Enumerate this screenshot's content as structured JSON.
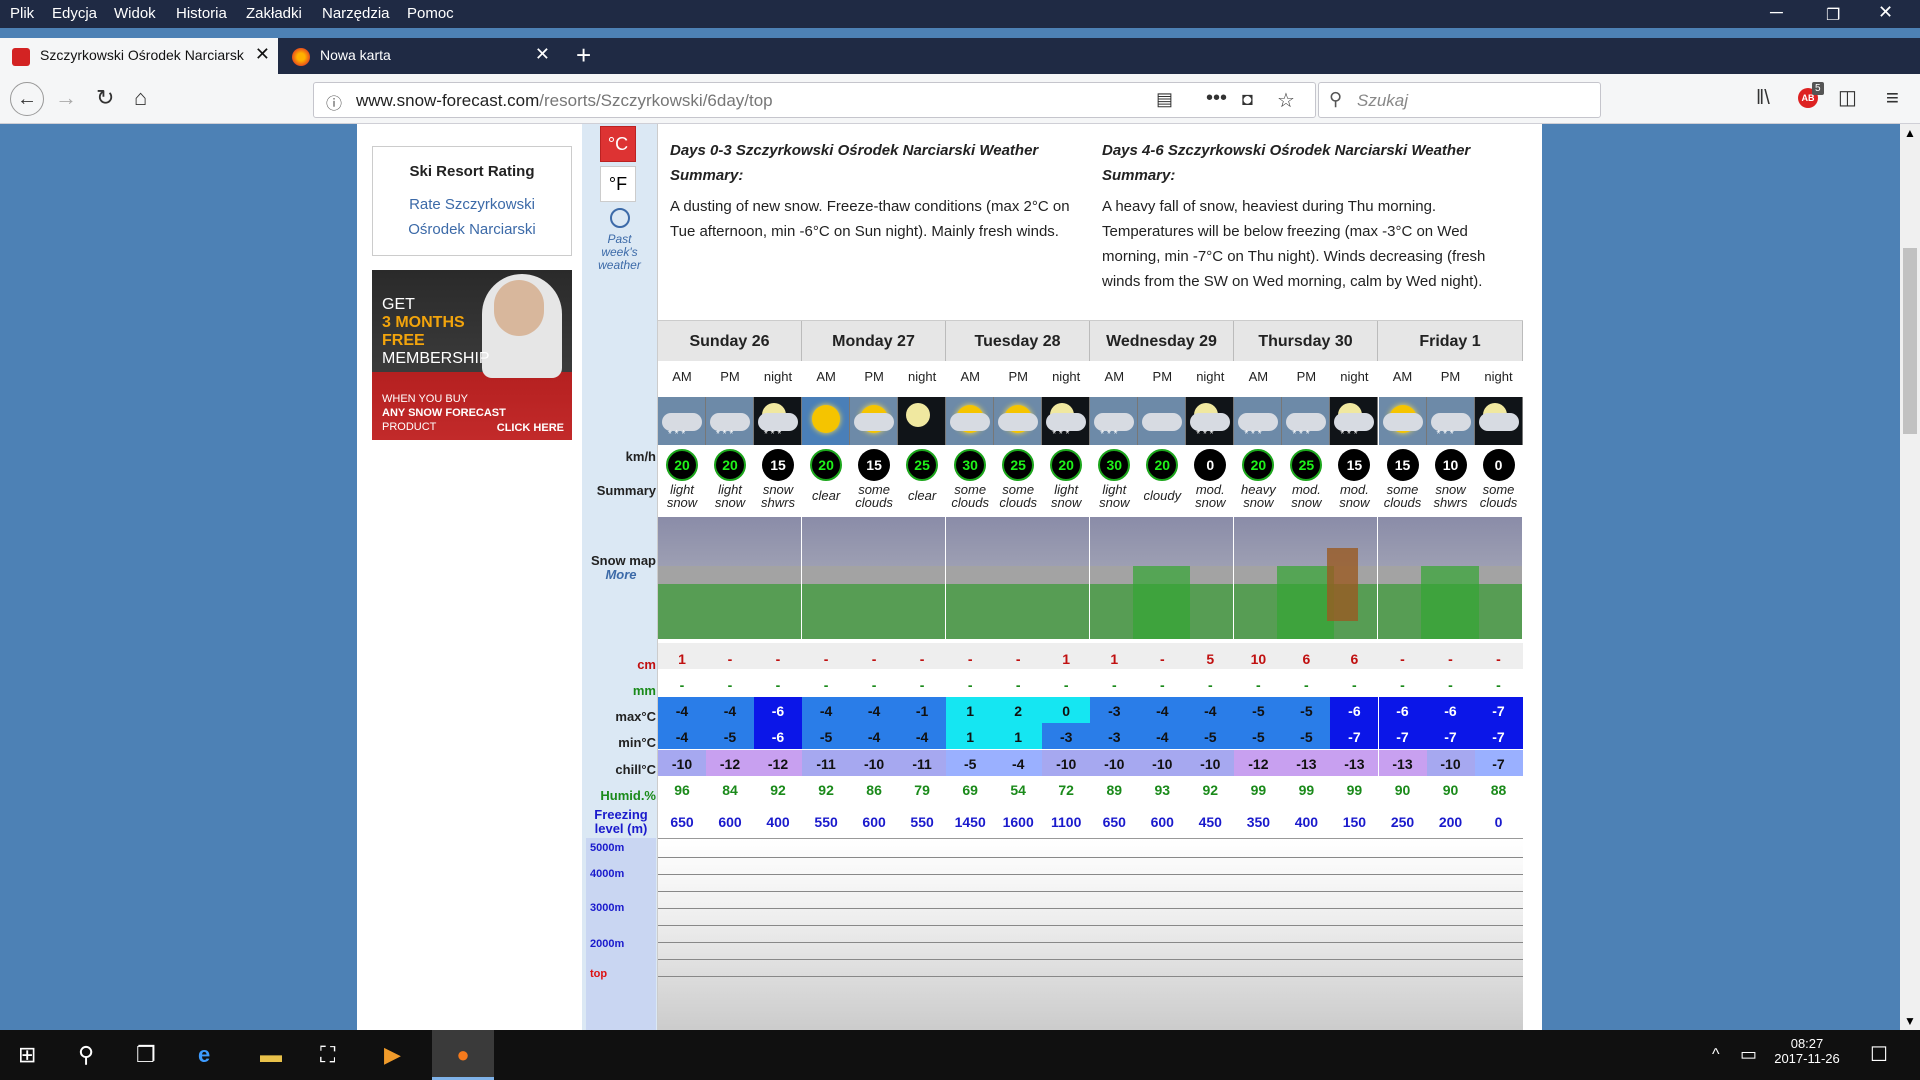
{
  "menu": [
    "Plik",
    "Edycja",
    "Widok",
    "Historia",
    "Zakładki",
    "Narzędzia",
    "Pomoc"
  ],
  "tabs": [
    {
      "label": "Szczyrkowski Ośrodek Narciarsk"
    },
    {
      "label": "Nowa karta"
    }
  ],
  "url": {
    "host": "www.snow-forecast.com",
    "path": "/resorts/Szczyrkowski/6day/top"
  },
  "search": {
    "placeholder": "Szukaj"
  },
  "addon_badge": "5",
  "left": {
    "rating_title": "Ski Resort Rating",
    "rating_link_1": "Rate Szczyrkowski",
    "rating_link_2": "Ośrodek Narciarski",
    "ad": {
      "l1": "GET",
      "l2": "3 MONTHS",
      "l3": "FREE",
      "l4": "MEMBERSHIP",
      "l5": "WHEN YOU BUY",
      "l6": "ANY SNOW FORECAST",
      "l7": "PRODUCT",
      "cta": "CLICK HERE"
    }
  },
  "units": {
    "c": "°C",
    "f": "°F"
  },
  "past": {
    "l1": "Past",
    "l2": "week's",
    "l3": "weather"
  },
  "summary": [
    {
      "title": "Days 0-3 Szczyrkowski Ośrodek Narciarski Weather Summary:",
      "text": "A dusting of new snow. Freeze-thaw conditions (max 2°C on Tue afternoon, min -6°C on Sun night). Mainly fresh winds."
    },
    {
      "title": "Days 4-6 Szczyrkowski Ośrodek Narciarski Weather Summary:",
      "text": "A heavy fall of snow, heaviest during Thu morning. Temperatures will be below freezing (max -3°C on Wed morning, min -7°C on Thu night). Winds decreasing (fresh winds from the SW on Wed morning, calm by Wed night)."
    }
  ],
  "days": [
    "Sunday 26",
    "Monday 27",
    "Tuesday 28",
    "Wednesday 29",
    "Thursday 30",
    "Friday 1"
  ],
  "periods": [
    "AM",
    "PM",
    "night"
  ],
  "labels": {
    "kmh": "km/h",
    "summary": "Summary",
    "snowmap": "Snow map",
    "more": "More",
    "cm": "cm",
    "mm": "mm",
    "max": "max°C",
    "min": "min°C",
    "chill": "chill°C",
    "humid": "Humid.%",
    "freezing_1": "Freezing",
    "freezing_2": "level (m)",
    "alt": [
      "5000m",
      "4000m",
      "3000m",
      "2000m",
      "top"
    ]
  },
  "icons": [
    "light-snow",
    "light-snow",
    "snow-showers-night",
    "clear-sun",
    "some-clouds-sun",
    "clear-night",
    "some-clouds-sun",
    "some-clouds-sun",
    "light-snow-night",
    "light-snow",
    "cloudy",
    "mod-snow-night",
    "heavy-snow",
    "mod-snow",
    "mod-snow-night",
    "some-clouds-sun",
    "snow-showers",
    "some-clouds-night"
  ],
  "wind": [
    20,
    20,
    15,
    20,
    15,
    25,
    30,
    25,
    20,
    30,
    20,
    0,
    20,
    25,
    15,
    15,
    10,
    0
  ],
  "wind_green": [
    true,
    true,
    false,
    true,
    false,
    true,
    true,
    true,
    true,
    true,
    true,
    false,
    true,
    true,
    false,
    false,
    false,
    false
  ],
  "summ": [
    [
      "light",
      "snow"
    ],
    [
      "light",
      "snow"
    ],
    [
      "snow",
      "shwrs"
    ],
    [
      "clear",
      ""
    ],
    [
      "some",
      "clouds"
    ],
    [
      "clear",
      ""
    ],
    [
      "some",
      "clouds"
    ],
    [
      "some",
      "clouds"
    ],
    [
      "light",
      "snow"
    ],
    [
      "light",
      "snow"
    ],
    [
      "cloudy",
      ""
    ],
    [
      "mod.",
      "snow"
    ],
    [
      "heavy",
      "snow"
    ],
    [
      "mod.",
      "snow"
    ],
    [
      "mod.",
      "snow"
    ],
    [
      "some",
      "clouds"
    ],
    [
      "snow",
      "shwrs"
    ],
    [
      "some",
      "clouds"
    ]
  ],
  "snow_cm": [
    "1",
    "-",
    "-",
    "-",
    "-",
    "-",
    "-",
    "-",
    "1",
    "1",
    "-",
    "5",
    "10",
    "6",
    "6",
    "-",
    "-",
    "-"
  ],
  "rain_mm": [
    "-",
    "-",
    "-",
    "-",
    "-",
    "-",
    "-",
    "-",
    "-",
    "-",
    "-",
    "-",
    "-",
    "-",
    "-",
    "-",
    "-",
    "-"
  ],
  "max_c": [
    "-4",
    "-4",
    "-6",
    "-4",
    "-4",
    "-1",
    "1",
    "2",
    "0",
    "-3",
    "-4",
    "-4",
    "-5",
    "-5",
    "-6",
    "-6",
    "-6",
    "-7"
  ],
  "min_c": [
    "-4",
    "-5",
    "-6",
    "-5",
    "-4",
    "-4",
    "1",
    "1",
    "-3",
    "-3",
    "-4",
    "-5",
    "-5",
    "-5",
    "-7",
    "-7",
    "-7",
    "-7"
  ],
  "chill_c": [
    "-10",
    "-12",
    "-12",
    "-11",
    "-10",
    "-11",
    "-5",
    "-4",
    "-10",
    "-10",
    "-10",
    "-10",
    "-12",
    "-13",
    "-13",
    "-13",
    "-10",
    "-7"
  ],
  "humid": [
    "96",
    "84",
    "92",
    "92",
    "86",
    "79",
    "69",
    "54",
    "72",
    "89",
    "93",
    "92",
    "99",
    "99",
    "99",
    "90",
    "90",
    "88"
  ],
  "freezing": [
    "650",
    "600",
    "400",
    "550",
    "600",
    "550",
    "1450",
    "1600",
    "1100",
    "650",
    "600",
    "450",
    "350",
    "400",
    "150",
    "250",
    "200",
    "0"
  ],
  "clock": {
    "time": "08:27",
    "date": "2017-11-26"
  }
}
